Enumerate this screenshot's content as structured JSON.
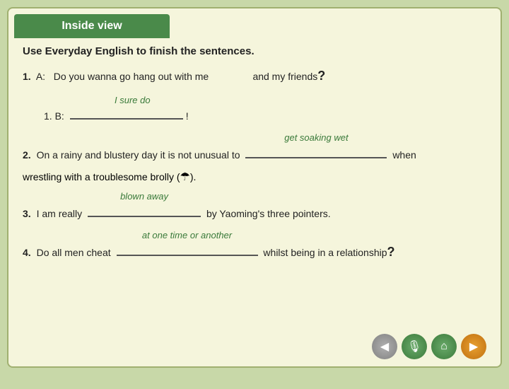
{
  "header": {
    "title": "Inside view"
  },
  "instruction": "Use Everyday English to finish the sentences.",
  "items": [
    {
      "number": "1.",
      "label": "A:",
      "text_before": "Do you wanna go hang out with me",
      "text_middle": "and my friends",
      "text_after": "?",
      "sub": {
        "number": "1.",
        "label": "B:",
        "blank": "_______________",
        "end": "!",
        "answer": "I sure do"
      }
    },
    {
      "number": "2.",
      "text_before": "On a rainy and blustery day it is not unusual to",
      "blank": "____________________",
      "text_after": "when wrestling with a troublesome brolly (☂).",
      "answer": "get soaking wet"
    },
    {
      "number": "3.",
      "text_before": "I am really",
      "blank": "___________________",
      "text_after": "by Yaoming's three pointers.",
      "answer": "blown away"
    },
    {
      "number": "4.",
      "text_before": "Do all men cheat",
      "blank": "____________________________",
      "text_after": "whilst being in a relationship",
      "end": "?",
      "answer": "at one time or another"
    }
  ],
  "nav": {
    "prev": "◀",
    "mic": "🎙",
    "home": "⌂",
    "next": "▶"
  }
}
